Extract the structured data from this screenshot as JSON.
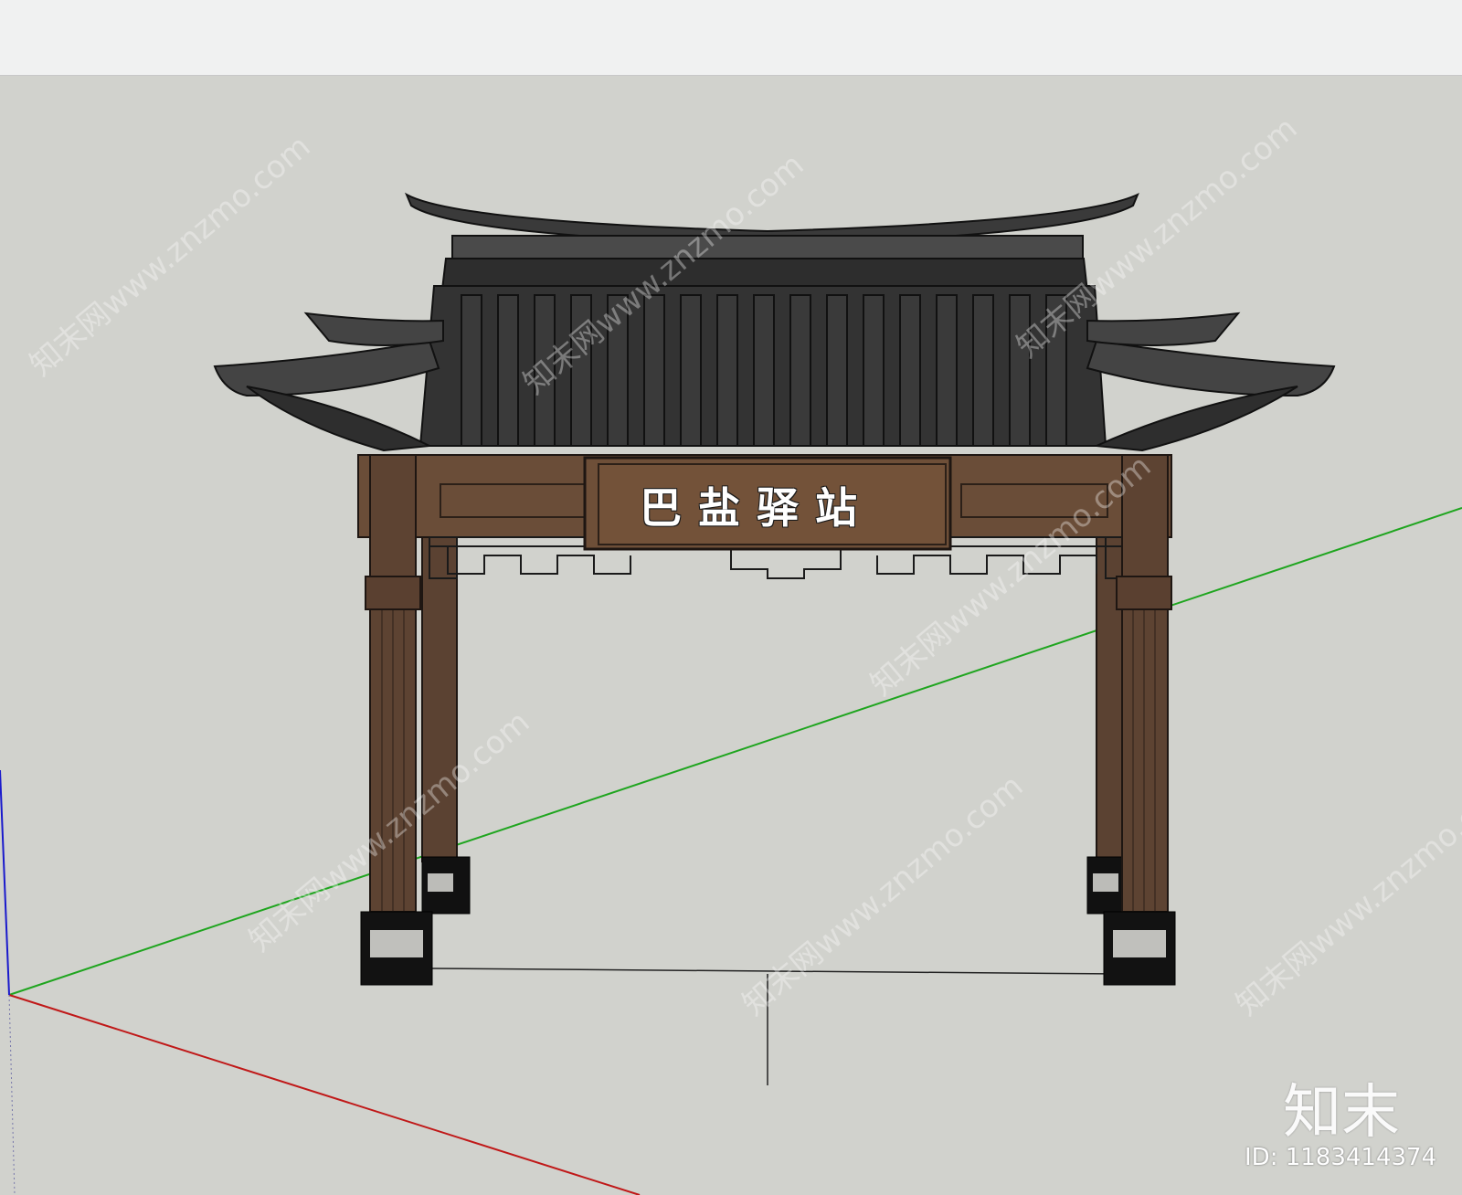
{
  "sign": {
    "text": "巴盐驿站"
  },
  "brand": {
    "logo": "知末",
    "id_label": "ID: 1183414374"
  },
  "watermark": {
    "text": "知末网www.znzmo.com"
  },
  "colors": {
    "background": "#d1d2cd",
    "axis_green": "#1fa51f",
    "axis_red": "#c01818",
    "axis_blue": "#1a1acc",
    "wood": "#5a4030",
    "roof": "#2b2b2b"
  }
}
